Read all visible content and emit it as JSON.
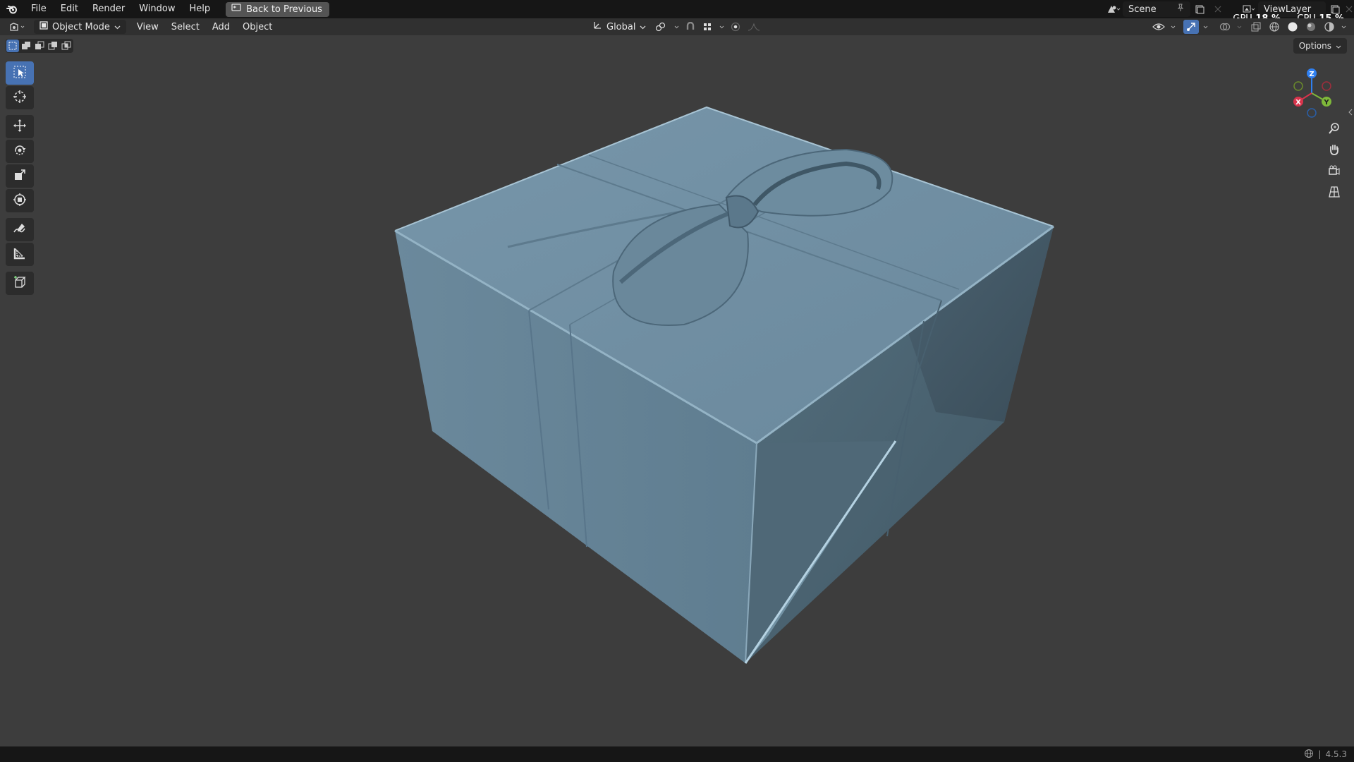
{
  "topbar": {
    "menus": [
      "File",
      "Edit",
      "Render",
      "Window",
      "Help"
    ],
    "back_button": "Back to Previous",
    "scene_name": "Scene",
    "view_layer": "ViewLayer",
    "gpu_label": "GPU",
    "gpu_value": "18 %",
    "cpu_label": "CPU",
    "cpu_value": "15 %"
  },
  "header": {
    "mode": "Object Mode",
    "menus": [
      "View",
      "Select",
      "Add",
      "Object"
    ],
    "transform_orientation": "Global"
  },
  "options_label": "Options",
  "gizmo": {
    "z": "Z",
    "y": "Y",
    "x": "X"
  },
  "statusbar": {
    "version": "4.5.3"
  },
  "colors": {
    "accent": "#4772b3",
    "object_base": "#6e8ea3",
    "background": "#3d3d3d"
  }
}
